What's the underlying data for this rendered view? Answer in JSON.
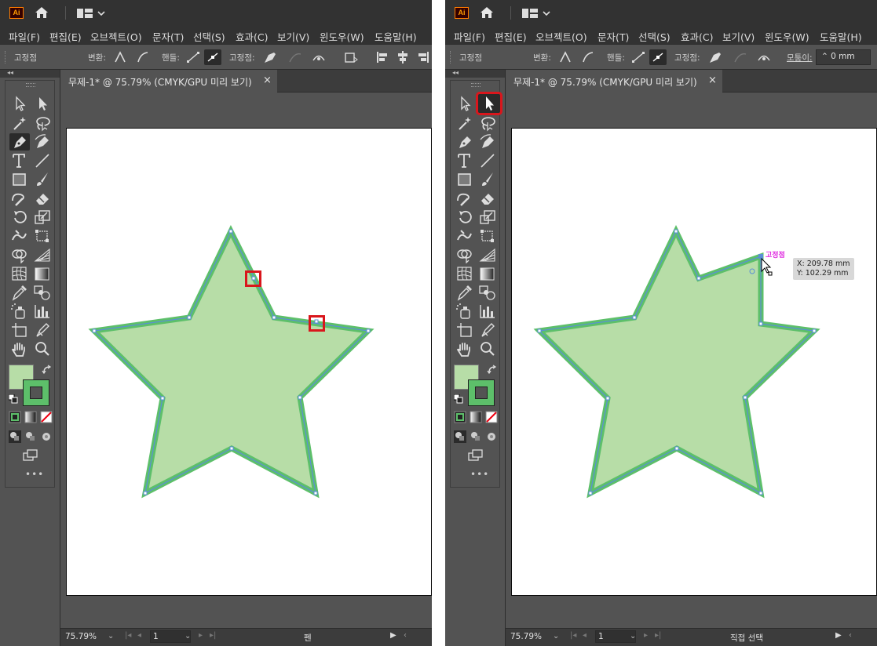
{
  "app": {
    "logo": "Ai"
  },
  "menu": [
    "파일(F)",
    "편집(E)",
    "오브젝트(O)",
    "문자(T)",
    "선택(S)",
    "효과(C)",
    "보기(V)",
    "윈도우(W)",
    "도움말(H)"
  ],
  "control": {
    "anchor_label": "고정점",
    "convert_label": "변환:",
    "handles_label": "핸들:",
    "anchors_label": "고정점:",
    "corners_label": "모퉁이:",
    "corners_value": "0 mm"
  },
  "document": {
    "tab_title": "무제-1* @ 75.79% (CMYK/GPU 미리 보기)",
    "close": "×"
  },
  "status": {
    "zoom": "75.79%",
    "page": "1"
  },
  "left_panel": {
    "active_tool": "pen-tool",
    "status_tool": "펜"
  },
  "right_panel": {
    "active_tool": "direct-selection-tool",
    "status_tool": "직접 선택",
    "anchor_hint": "고정점",
    "tooltip_x": "X: 209.78 mm",
    "tooltip_y": "Y: 102.29 mm"
  },
  "colors": {
    "fill": "#b7dda7",
    "stroke": "#5dbf6a",
    "path": "#5b8fd6",
    "highlight": "#d9161c"
  },
  "icons": [
    "ai-logo",
    "home-icon",
    "workspace-icon",
    "direct-selection-icon",
    "selection-icon",
    "magic-wand-icon",
    "lasso-icon",
    "pen-icon",
    "curvature-icon",
    "type-icon",
    "line-icon",
    "rectangle-icon",
    "paintbrush-icon",
    "shaper-icon",
    "eraser-icon",
    "rotate-icon",
    "scale-icon",
    "warp-icon",
    "free-transform-icon",
    "shape-builder-icon",
    "perspective-icon",
    "mesh-icon",
    "gradient-icon",
    "eyedropper-icon",
    "blend-icon",
    "symbol-sprayer-icon",
    "graph-icon",
    "artboard-icon",
    "slice-icon",
    "hand-icon",
    "zoom-icon"
  ]
}
